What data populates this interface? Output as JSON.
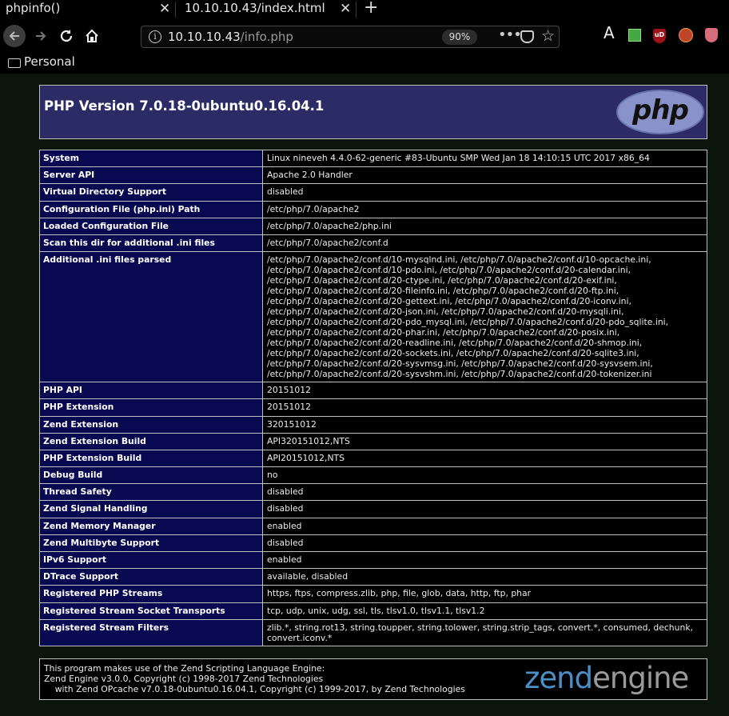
{
  "browser": {
    "tabs": [
      {
        "label": "phpinfo()"
      },
      {
        "label": "10.10.10.43/index.html"
      }
    ],
    "new_tab_glyph": "+",
    "close_glyph": "✕",
    "url_host": "10.10.10.43",
    "url_path": "/info.php",
    "zoom": "90%",
    "bookmarks": [
      {
        "label": "Personal"
      }
    ],
    "extension_letter": "A"
  },
  "header": {
    "title": "PHP Version 7.0.18-0ubuntu0.16.04.1",
    "logo_text": "php"
  },
  "rows": [
    {
      "key": "System",
      "value": "Linux nineveh 4.4.0-62-generic #83-Ubuntu SMP Wed Jan 18 14:10:15 UTC 2017 x86_64"
    },
    {
      "key": "Server API",
      "value": "Apache 2.0 Handler"
    },
    {
      "key": "Virtual Directory Support",
      "value": "disabled"
    },
    {
      "key": "Configuration File (php.ini) Path",
      "value": "/etc/php/7.0/apache2"
    },
    {
      "key": "Loaded Configuration File",
      "value": "/etc/php/7.0/apache2/php.ini"
    },
    {
      "key": "Scan this dir for additional .ini files",
      "value": "/etc/php/7.0/apache2/conf.d"
    },
    {
      "key": "Additional .ini files parsed",
      "value": "/etc/php/7.0/apache2/conf.d/10-mysqlnd.ini, /etc/php/7.0/apache2/conf.d/10-opcache.ini, /etc/php/7.0/apache2/conf.d/10-pdo.ini, /etc/php/7.0/apache2/conf.d/20-calendar.ini, /etc/php/7.0/apache2/conf.d/20-ctype.ini, /etc/php/7.0/apache2/conf.d/20-exif.ini, /etc/php/7.0/apache2/conf.d/20-fileinfo.ini, /etc/php/7.0/apache2/conf.d/20-ftp.ini, /etc/php/7.0/apache2/conf.d/20-gettext.ini, /etc/php/7.0/apache2/conf.d/20-iconv.ini, /etc/php/7.0/apache2/conf.d/20-json.ini, /etc/php/7.0/apache2/conf.d/20-mysqli.ini, /etc/php/7.0/apache2/conf.d/20-pdo_mysql.ini, /etc/php/7.0/apache2/conf.d/20-pdo_sqlite.ini, /etc/php/7.0/apache2/conf.d/20-phar.ini, /etc/php/7.0/apache2/conf.d/20-posix.ini, /etc/php/7.0/apache2/conf.d/20-readline.ini, /etc/php/7.0/apache2/conf.d/20-shmop.ini, /etc/php/7.0/apache2/conf.d/20-sockets.ini, /etc/php/7.0/apache2/conf.d/20-sqlite3.ini, /etc/php/7.0/apache2/conf.d/20-sysvmsg.ini, /etc/php/7.0/apache2/conf.d/20-sysvsem.ini, /etc/php/7.0/apache2/conf.d/20-sysvshm.ini, /etc/php/7.0/apache2/conf.d/20-tokenizer.ini"
    },
    {
      "key": "PHP API",
      "value": "20151012"
    },
    {
      "key": "PHP Extension",
      "value": "20151012"
    },
    {
      "key": "Zend Extension",
      "value": "320151012"
    },
    {
      "key": "Zend Extension Build",
      "value": "API320151012,NTS"
    },
    {
      "key": "PHP Extension Build",
      "value": "API20151012,NTS"
    },
    {
      "key": "Debug Build",
      "value": "no"
    },
    {
      "key": "Thread Safety",
      "value": "disabled"
    },
    {
      "key": "Zend Signal Handling",
      "value": "disabled"
    },
    {
      "key": "Zend Memory Manager",
      "value": "enabled"
    },
    {
      "key": "Zend Multibyte Support",
      "value": "disabled"
    },
    {
      "key": "IPv6 Support",
      "value": "enabled"
    },
    {
      "key": "DTrace Support",
      "value": "available, disabled"
    },
    {
      "key": "Registered PHP Streams",
      "value": "https, ftps, compress.zlib, php, file, glob, data, http, ftp, phar"
    },
    {
      "key": "Registered Stream Socket Transports",
      "value": "tcp, udp, unix, udg, ssl, tls, tlsv1.0, tlsv1.1, tlsv1.2"
    },
    {
      "key": "Registered Stream Filters",
      "value": "zlib.*, string.rot13, string.toupper, string.tolower, string.strip_tags, convert.*, consumed, dechunk, convert.iconv.*"
    }
  ],
  "footer": {
    "text": "This program makes use of the Zend Scripting Language Engine:\nZend Engine v3.0.0, Copyright (c) 1998-2017 Zend Technologies\n    with Zend OPcache v7.0.18-0ubuntu0.16.04.1, Copyright (c) 1999-2017, by Zend Technologies",
    "logo_word1": "zend",
    "logo_word2": "engine"
  }
}
